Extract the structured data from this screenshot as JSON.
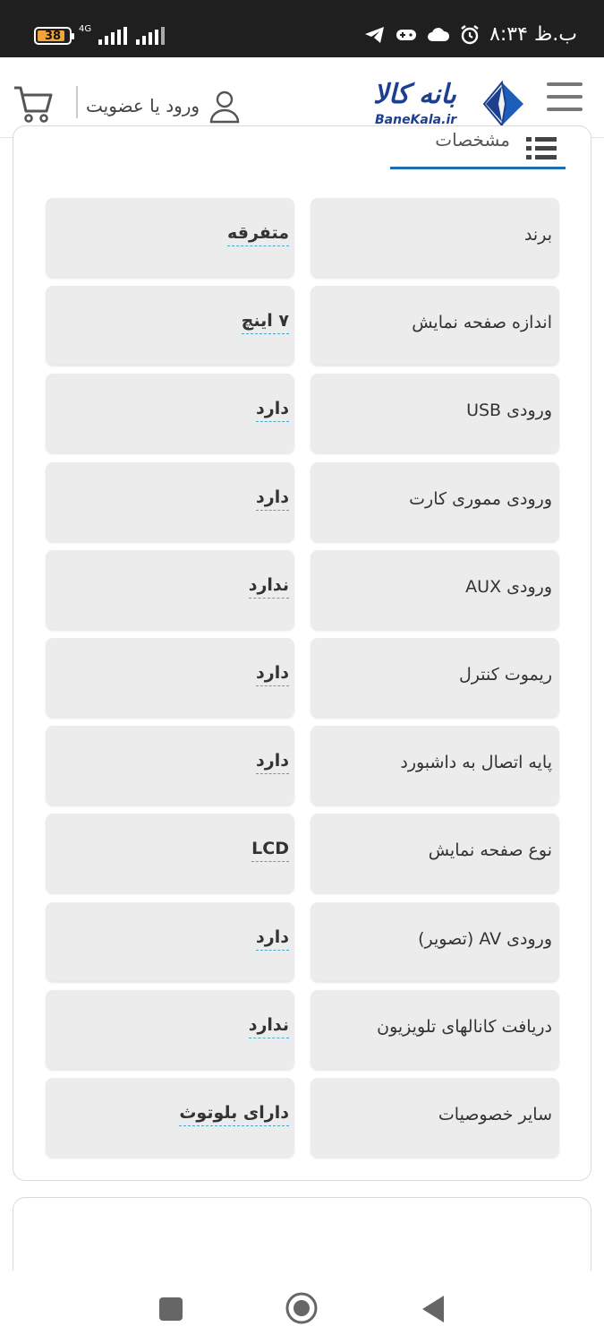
{
  "status_bar": {
    "time": "۸:۳۴ ب.ظ",
    "battery_level": "38",
    "network": "4G",
    "icons": [
      "alarm-icon",
      "cloud-icon",
      "gamepad-icon",
      "telegram-icon"
    ]
  },
  "header": {
    "logo_text": "بانه کالا",
    "logo_sub": "BaneKala.ir",
    "login_label": "ورود یا عضویت",
    "colors": {
      "brand": "#1d3f8f",
      "accent": "#1a6fb4"
    }
  },
  "specs": {
    "title": "مشخصات",
    "rows": [
      {
        "label": "برند",
        "value": "متفرقه"
      },
      {
        "label": "اندازه صفحه نمایش",
        "value": "۷ اینچ"
      },
      {
        "label": "ورودی USB",
        "value": "دارد"
      },
      {
        "label": "ورودی مموری کارت",
        "value": "دارد"
      },
      {
        "label": "ورودی AUX",
        "value": "ندارد"
      },
      {
        "label": "ریموت کنترل",
        "value": "دارد"
      },
      {
        "label": "پایه اتصال به داشبورد",
        "value": "دارد"
      },
      {
        "label": "نوع صفحه نمایش",
        "value": "LCD"
      },
      {
        "label": "ورودی AV (تصویر)",
        "value": "دارد"
      },
      {
        "label": "دریافت کانالهای تلویزیون",
        "value": "ندارد"
      },
      {
        "label": "سایر خصوصیات",
        "value": "دارای بلوتوث"
      }
    ]
  }
}
